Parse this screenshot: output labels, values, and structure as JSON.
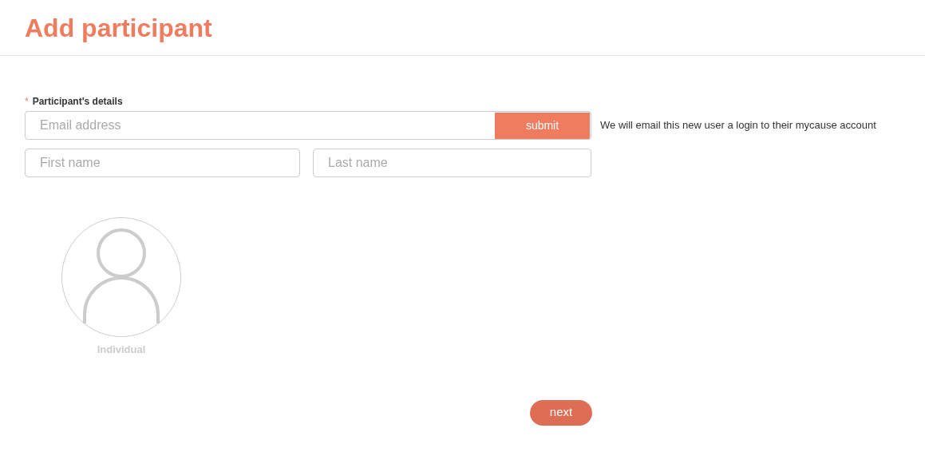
{
  "title": "Add participant",
  "details": {
    "required_mark": "*",
    "label": "Participant's details"
  },
  "email": {
    "placeholder": "Email address"
  },
  "submit": "submit",
  "note": "We will email this new user a login to their mycause account",
  "first_name": {
    "placeholder": "First name"
  },
  "last_name": {
    "placeholder": "Last name"
  },
  "participant_types": [
    {
      "label": "Individual",
      "selected": false
    }
  ],
  "next": "next"
}
